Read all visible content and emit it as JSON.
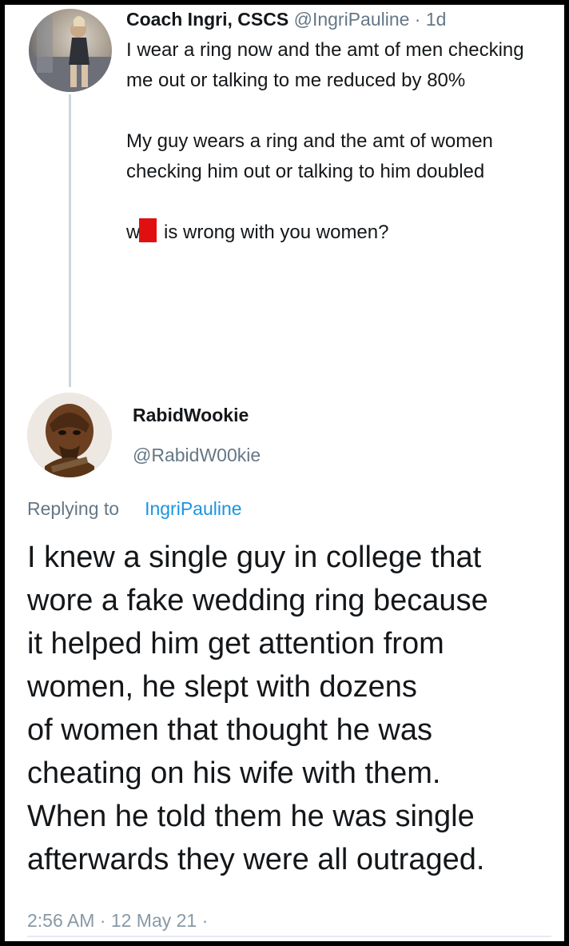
{
  "parent_tweet": {
    "display_name": "Coach Ingri, CSCS",
    "handle": "@IngriPauline",
    "separator": " · ",
    "age": "1d",
    "paragraph_1": "I wear a ring now and the amt of men checking me out or talking to me reduced by 80%",
    "paragraph_2": "My guy wears a ring and the amt of women checking him out or talking to him doubled",
    "paragraph_3_start": "w",
    "paragraph_3_end": " is wrong with you women?"
  },
  "reply_tweet": {
    "display_name": "RabidWookie",
    "handle": "@RabidW00kie",
    "replying_to_label": "Replying to",
    "replying_to_user": "IngriPauline",
    "body_lines": [
      "I knew a single guy in college that",
      "wore a fake wedding ring because",
      "it helped him get attention from",
      "women, he slept with dozens",
      "of women that thought he was",
      "cheating on his wife with them.",
      "When he told them he was single",
      "afterwards they were all outraged."
    ],
    "timestamp": "2:56 AM · 12 May 21 ·"
  }
}
